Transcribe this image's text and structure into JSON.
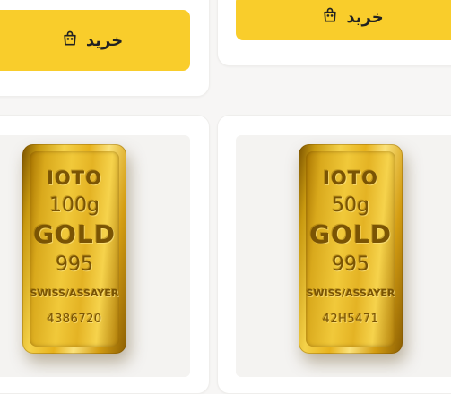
{
  "cards": [
    {
      "buy_label": "خرید",
      "bar": {
        "brand": "IOTO",
        "weight": "100g",
        "metal": "GOLD",
        "purity": "995",
        "assayer": "SWISS/ASSAYER",
        "serial": "4386720"
      }
    },
    {
      "buy_label": "خرید",
      "bar": {
        "brand": "IOTO",
        "weight": "50g",
        "metal": "GOLD",
        "purity": "995",
        "assayer": "SWISS/ASSAYER",
        "serial": "42H5471"
      }
    }
  ],
  "icons": {
    "buy": "shopping-bag-icon"
  },
  "colors": {
    "accent": "#f9cd2b",
    "background": "#f7f6f5",
    "card": "#ffffff"
  }
}
